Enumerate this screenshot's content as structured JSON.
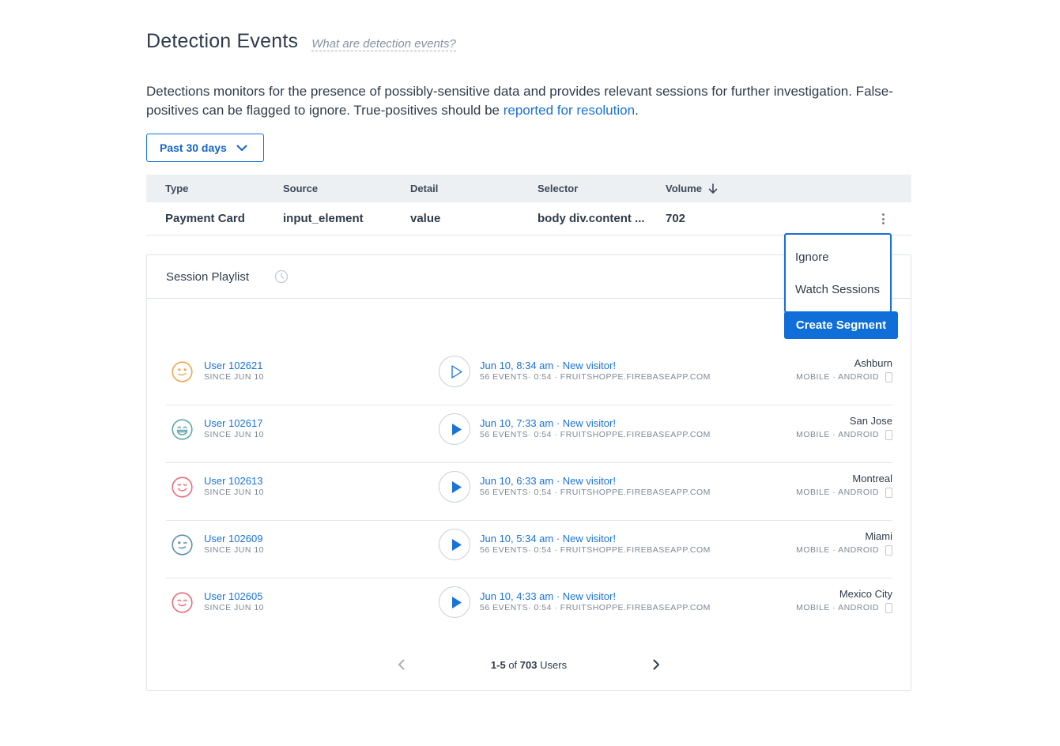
{
  "header": {
    "title": "Detection Events",
    "help_link": "What are detection events?"
  },
  "description": {
    "text_before": "Detections monitors for the presence of possibly-sensitive data and provides relevant sessions for further investigation. False-positives can be flagged to ignore. True-positives should be ",
    "link": "reported for resolution",
    "text_after": "."
  },
  "filter": {
    "range_label": "Past 30 days"
  },
  "table": {
    "columns": [
      "Type",
      "Source",
      "Detail",
      "Selector",
      "Volume"
    ],
    "sort_column": "Volume",
    "rows": [
      {
        "type": "Payment Card",
        "source": "input_element",
        "detail": "value",
        "selector": "body div.content ...",
        "volume": "702"
      }
    ]
  },
  "row_menu": {
    "items": [
      "Ignore",
      "Watch Sessions"
    ],
    "primary_action": "Create Segment"
  },
  "playlist": {
    "title": "Session Playlist",
    "sessions": [
      {
        "user": "User 102621",
        "since": "SINCE JUN 10",
        "title": "Jun 10, 8:34 am · New visitor!",
        "meta": "56 EVENTS· 0:54 · FRUITSHOPPE.FIREBASEAPP.COM",
        "city": "Ashburn",
        "device": "MOBILE · ANDROID",
        "face_color": "#f0a64a",
        "face_icon": "smirk-face-icon",
        "play_filled": false
      },
      {
        "user": "User 102617",
        "since": "SINCE JUN 10",
        "title": "Jun 10, 7:33 am · New visitor!",
        "meta": "56 EVENTS· 0:54 · FRUITSHOPPE.FIREBASEAPP.COM",
        "city": "San Jose",
        "device": "MOBILE · ANDROID",
        "face_color": "#5fa8a8",
        "face_icon": "grin-face-icon",
        "play_filled": true
      },
      {
        "user": "User 102613",
        "since": "SINCE JUN 10",
        "title": "Jun 10, 6:33 am · New visitor!",
        "meta": "56 EVENTS· 0:54 · FRUITSHOPPE.FIREBASEAPP.COM",
        "city": "Montreal",
        "device": "MOBILE · ANDROID",
        "face_color": "#ec6a7a",
        "face_icon": "content-face-icon",
        "play_filled": true
      },
      {
        "user": "User 102609",
        "since": "SINCE JUN 10",
        "title": "Jun 10, 5:34 am · New visitor!",
        "meta": "56 EVENTS· 0:54 · FRUITSHOPPE.FIREBASEAPP.COM",
        "city": "Miami",
        "device": "MOBILE · ANDROID",
        "face_color": "#5b8fb0",
        "face_icon": "wink-face-icon",
        "play_filled": true
      },
      {
        "user": "User 102605",
        "since": "SINCE JUN 10",
        "title": "Jun 10, 4:33 am · New visitor!",
        "meta": "56 EVENTS· 0:54 · FRUITSHOPPE.FIREBASEAPP.COM",
        "city": "Mexico City",
        "device": "MOBILE · ANDROID",
        "face_color": "#ec6a7a",
        "face_icon": "smile-face-icon",
        "play_filled": true
      }
    ],
    "pager": {
      "range": "1-5",
      "of": "of",
      "total": "703",
      "unit": "Users"
    }
  },
  "colors": {
    "accent": "#1a73d6",
    "primary_button": "#0f6ed8"
  }
}
